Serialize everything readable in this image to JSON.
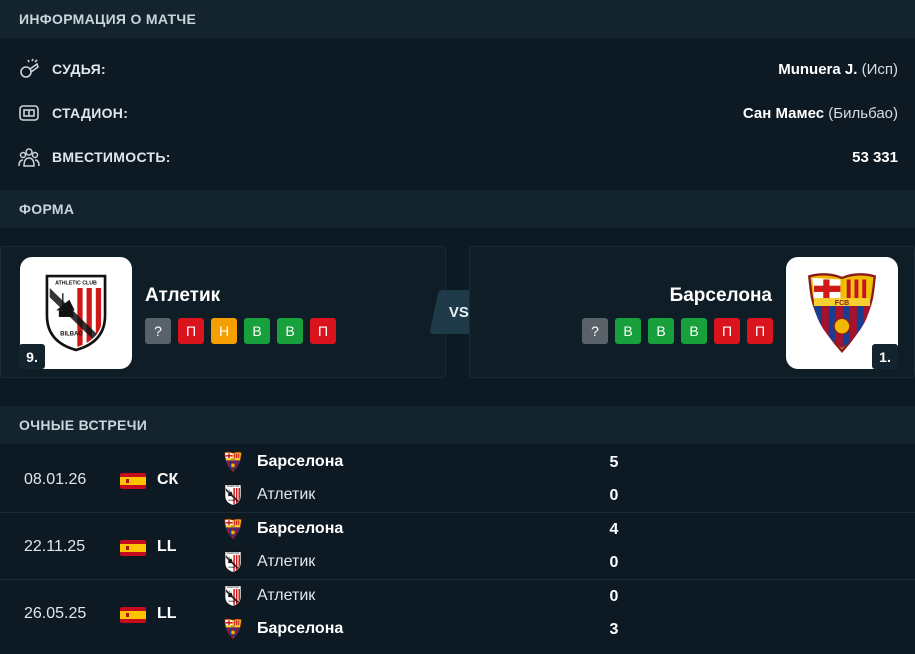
{
  "match_info": {
    "header": "ИНФОРМАЦИЯ О МАТЧЕ",
    "referee": {
      "label": "СУДЬЯ:",
      "value": "Munuera J.",
      "suffix": "(Исп)",
      "icon": "whistle-icon"
    },
    "stadium": {
      "label": "СТАДИОН:",
      "value": "Сан Мамес",
      "suffix": "(Бильбао)",
      "icon": "stadium-icon"
    },
    "capacity": {
      "label": "ВМЕСТИМОСТЬ:",
      "value": "53 331",
      "icon": "crowd-icon"
    }
  },
  "form": {
    "header": "ФОРМА",
    "vs_label": "VS",
    "home": {
      "name": "Атлетик",
      "rank": "9.",
      "results": [
        "?",
        "П",
        "Н",
        "В",
        "В",
        "П"
      ],
      "logo": "athletic-club-logo"
    },
    "away": {
      "name": "Барселона",
      "rank": "1.",
      "results": [
        "?",
        "В",
        "В",
        "В",
        "П",
        "П"
      ],
      "logo": "fc-barcelona-logo"
    }
  },
  "h2h": {
    "header": "ОЧНЫЕ ВСТРЕЧИ",
    "matches": [
      {
        "date": "08.01.26",
        "competition": "СК",
        "flag": "spain-flag",
        "team1": "Барселона",
        "score1": "5",
        "team2": "Атлетик",
        "score2": "0"
      },
      {
        "date": "22.11.25",
        "competition": "LL",
        "flag": "spain-flag",
        "team1": "Барселона",
        "score1": "4",
        "team2": "Атлетик",
        "score2": "0"
      },
      {
        "date": "26.05.25",
        "competition": "LL",
        "flag": "spain-flag",
        "team1": "Атлетик",
        "score1": "0",
        "team2": "Барселона",
        "score2": "3"
      }
    ]
  },
  "colors": {
    "background": "#0d1a23",
    "header": "#13242f",
    "loss": "#d9141c",
    "draw": "#f5a000",
    "win": "#18a03c",
    "unknown": "#5a6269"
  }
}
